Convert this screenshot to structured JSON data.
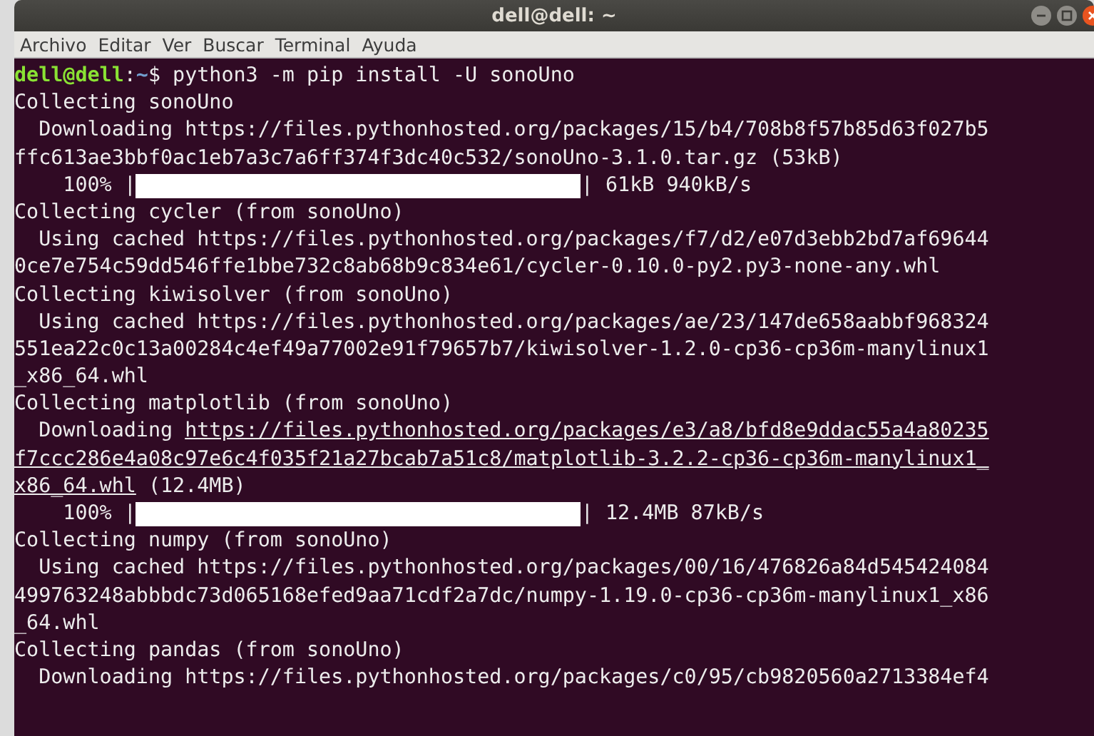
{
  "window": {
    "title": "dell@dell: ~"
  },
  "menu": [
    "Archivo",
    "Editar",
    "Ver",
    "Buscar",
    "Terminal",
    "Ayuda"
  ],
  "terminal": {
    "lines": [
      {
        "kind": "prompt",
        "user": "dell@dell",
        "sep": ":",
        "path": "~",
        "command": "$ python3 -m pip install -U sonoUno"
      },
      {
        "kind": "text",
        "segments": [
          {
            "text": "Collecting sonoUno",
            "underlined": false
          }
        ]
      },
      {
        "kind": "text",
        "segments": [
          {
            "text": "  Downloading https://files.pythonhosted.org/packages/15/b4/708b8f57b85d63f027b5",
            "underlined": false
          }
        ]
      },
      {
        "kind": "text",
        "segments": [
          {
            "text": "ffc613ae3bbf0ac1eb7a3c7a6ff374f3dc40c532/sonoUno-3.1.0.tar.gz (53kB)",
            "underlined": false
          }
        ]
      },
      {
        "kind": "progress",
        "percent": "    100% |",
        "level": 1,
        "reading": "| 61kB 940kB/s"
      },
      {
        "kind": "text",
        "segments": [
          {
            "text": "Collecting cycler (from sonoUno)",
            "underlined": false
          }
        ]
      },
      {
        "kind": "text",
        "segments": [
          {
            "text": "  Using cached https://files.pythonhosted.org/packages/f7/d2/e07d3ebb2bd7af69644",
            "underlined": false
          }
        ]
      },
      {
        "kind": "text",
        "segments": [
          {
            "text": "0ce7e754c59dd546ffe1bbe732c8ab68b9c834e61/cycler-0.10.0-py2.py3-none-any.whl",
            "underlined": false
          }
        ]
      },
      {
        "kind": "text",
        "segments": [
          {
            "text": "Collecting kiwisolver (from sonoUno)",
            "underlined": false
          }
        ]
      },
      {
        "kind": "text",
        "segments": [
          {
            "text": "  Using cached https://files.pythonhosted.org/packages/ae/23/147de658aabbf968324",
            "underlined": false
          }
        ]
      },
      {
        "kind": "text",
        "segments": [
          {
            "text": "551ea22c0c13a00284c4ef49a77002e91f79657b7/kiwisolver-1.2.0-cp36-cp36m-manylinux1",
            "underlined": false
          }
        ]
      },
      {
        "kind": "text",
        "segments": [
          {
            "text": "_x86_64.whl",
            "underlined": false
          }
        ]
      },
      {
        "kind": "text",
        "segments": [
          {
            "text": "Collecting matplotlib (from sonoUno)",
            "underlined": false
          }
        ]
      },
      {
        "kind": "text",
        "segments": [
          {
            "text": "  Downloading ",
            "underlined": false
          },
          {
            "text": "https://files.pythonhosted.org/packages/e3/a8/bfd8e9ddac55a4a80235",
            "underlined": true
          }
        ]
      },
      {
        "kind": "text",
        "segments": [
          {
            "text": "f7ccc286e4a08c97e6c4f035f21a27bcab7a51c8/matplotlib-3.2.2-cp36-cp36m-manylinux1_",
            "underlined": true
          }
        ]
      },
      {
        "kind": "text",
        "segments": [
          {
            "text": "x86_64.whl",
            "underlined": true
          },
          {
            "text": " (12.4MB)",
            "underlined": false
          }
        ]
      },
      {
        "kind": "progress",
        "percent": "    100% |",
        "level": 1,
        "reading": "| 12.4MB 87kB/s"
      },
      {
        "kind": "text",
        "segments": [
          {
            "text": "Collecting numpy (from sonoUno)",
            "underlined": false
          }
        ]
      },
      {
        "kind": "text",
        "segments": [
          {
            "text": "  Using cached https://files.pythonhosted.org/packages/00/16/476826a84d545424084",
            "underlined": false
          }
        ]
      },
      {
        "kind": "text",
        "segments": [
          {
            "text": "499763248abbbdc73d065168efed9aa71cdf2a7dc/numpy-1.19.0-cp36-cp36m-manylinux1_x86",
            "underlined": false
          }
        ]
      },
      {
        "kind": "text",
        "segments": [
          {
            "text": "_64.whl",
            "underlined": false
          }
        ]
      },
      {
        "kind": "text",
        "segments": [
          {
            "text": "Collecting pandas (from sonoUno)",
            "underlined": false
          }
        ]
      },
      {
        "kind": "text",
        "segments": [
          {
            "text": "  Downloading https://files.pythonhosted.org/packages/c0/95/cb9820560a2713384ef4",
            "underlined": false
          }
        ]
      }
    ]
  }
}
